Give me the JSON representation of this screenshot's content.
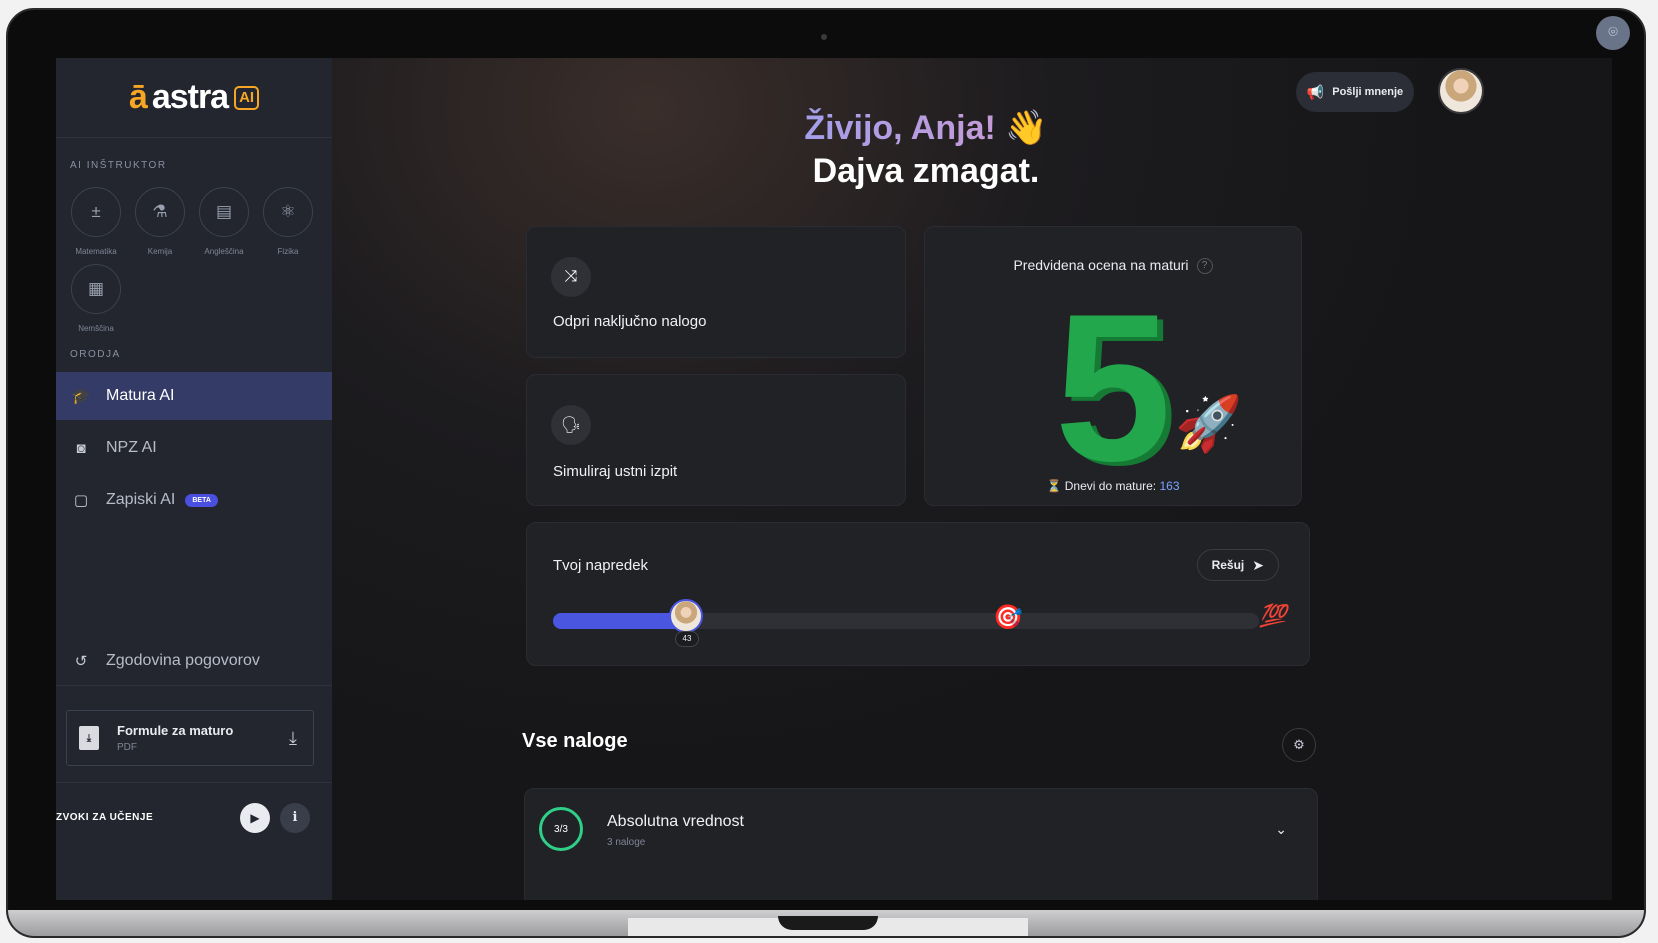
{
  "brand": {
    "logo_text": "astra",
    "logo_badge": "AI",
    "logo_mark": "ā"
  },
  "sidebar": {
    "instructor_title": "AI INŠTRUKTOR",
    "subjects": [
      {
        "label": "Matematika",
        "icon": "math-icon",
        "glyph": "±"
      },
      {
        "label": "Kemija",
        "icon": "flask-icon",
        "glyph": "⚗"
      },
      {
        "label": "Angleščina",
        "icon": "book-icon",
        "glyph": "▤"
      },
      {
        "label": "Fizika",
        "icon": "atom-icon",
        "glyph": "⚛"
      },
      {
        "label": "Nemščina",
        "icon": "language-icon",
        "glyph": "▦"
      }
    ],
    "tools_title": "ORODJA",
    "nav": [
      {
        "label": "Matura AI",
        "icon": "graduation-cap-icon",
        "glyph": "🎓",
        "active": true
      },
      {
        "label": "NPZ AI",
        "icon": "badge-icon",
        "glyph": "◙",
        "active": false
      },
      {
        "label": "Zapiski AI",
        "icon": "note-icon",
        "glyph": "▢",
        "active": false,
        "badge": "BETA"
      }
    ],
    "history_label": "Zgodovina pogovorov",
    "formule": {
      "title": "Formule za maturo",
      "subtitle": "PDF"
    },
    "sounds_label": "ZVOKI ZA UČENJE"
  },
  "header": {
    "feedback_label": "Pošlji mnenje",
    "greeting_line1": "Živijo, Anja!",
    "greeting_emoji": "👋",
    "greeting_line2": "Dajva zmagat."
  },
  "cards": {
    "random_task": "Odpri naključno nalogo",
    "oral_exam": "Simuliraj ustni izpit",
    "grade_title": "Predvidena ocena na maturi",
    "grade_value": "5",
    "days_label": "Dnevi do mature:",
    "days_value": "163"
  },
  "progress": {
    "title": "Tvoj napredek",
    "solve_label": "Rešuj",
    "value": 43,
    "value_label": "43",
    "target_fraction": 0.64,
    "fill_fraction": 0.19
  },
  "tasks": {
    "title": "Vse naloge",
    "items": [
      {
        "progress": "3/3",
        "name": "Absolutna vrednost",
        "count": "3 naloge"
      }
    ]
  },
  "colors": {
    "accent": "#4a56e0",
    "brand": "#f6a623",
    "grade": "#22a74c",
    "success": "#2fcf88"
  }
}
